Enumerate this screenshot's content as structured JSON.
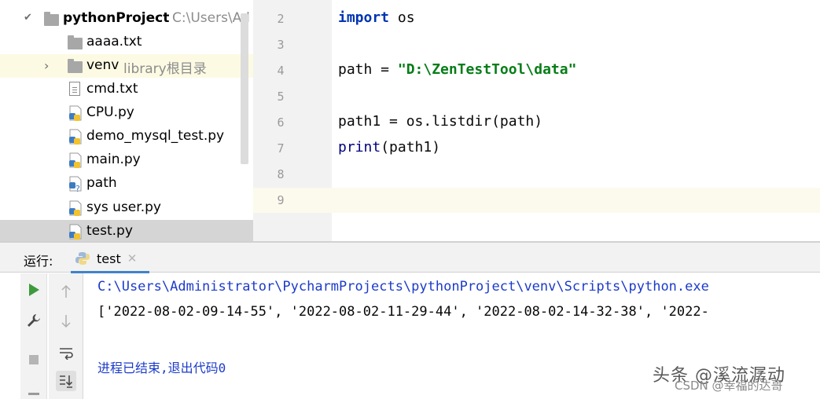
{
  "project_tree": {
    "root": {
      "name": "pythonProject",
      "path_hint": "C:\\Users\\Ad"
    },
    "items": [
      {
        "label": "aaaa.txt",
        "type": "text-file-icon"
      },
      {
        "label": "venv",
        "hint": "library根目录",
        "type": "folder-icon"
      },
      {
        "label": "cmd.txt",
        "type": "text-file-icon"
      },
      {
        "label": "CPU.py",
        "type": "python-file-icon"
      },
      {
        "label": "demo_mysql_test.py",
        "type": "python-file-icon"
      },
      {
        "label": "main.py",
        "type": "python-file-icon"
      },
      {
        "label": "path",
        "type": "unknown-python-file-icon"
      },
      {
        "label": "sys user.py",
        "type": "python-file-icon"
      },
      {
        "label": "test.py",
        "type": "python-file-icon"
      }
    ]
  },
  "editor": {
    "line_numbers": [
      "2",
      "3",
      "4",
      "5",
      "6",
      "7",
      "8",
      "9"
    ],
    "lines": {
      "l2_kw": "import",
      "l2_rest": " os",
      "l4_pre": "path = ",
      "l4_str": "\"D:\\ZenTestTool\\data\"",
      "l6": "path1 = os.listdir(path)",
      "l7_fn": "print",
      "l7_rest": "(path1)"
    }
  },
  "run_panel": {
    "title": "运行:",
    "tab_label": "test",
    "output": {
      "command": "C:\\Users\\Administrator\\PycharmProjects\\pythonProject\\venv\\Scripts\\python.exe",
      "result": "['2022-08-02-09-14-55', '2022-08-02-11-29-44', '2022-08-02-14-32-38', '2022-",
      "exit": "进程已结束,退出代码0"
    }
  },
  "watermark": {
    "main": "头条 @溪流潺动",
    "sub": "CSDN @幸福的达哥"
  },
  "colors": {
    "keyword": "#0033b3",
    "string": "#067d17",
    "run_green": "#3c9b3c",
    "console_blue": "#1c3bc9",
    "tab_underline": "#4083c9"
  }
}
